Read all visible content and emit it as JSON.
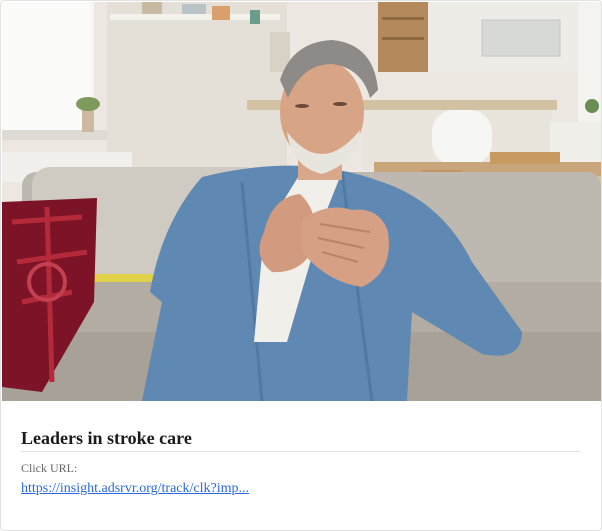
{
  "ad": {
    "headline": "Leaders in stroke care",
    "click_url_label": "Click URL:",
    "click_url": "https://insight.adsrvr.org/track/clk?imp..."
  },
  "image": {
    "subject": "photo"
  }
}
